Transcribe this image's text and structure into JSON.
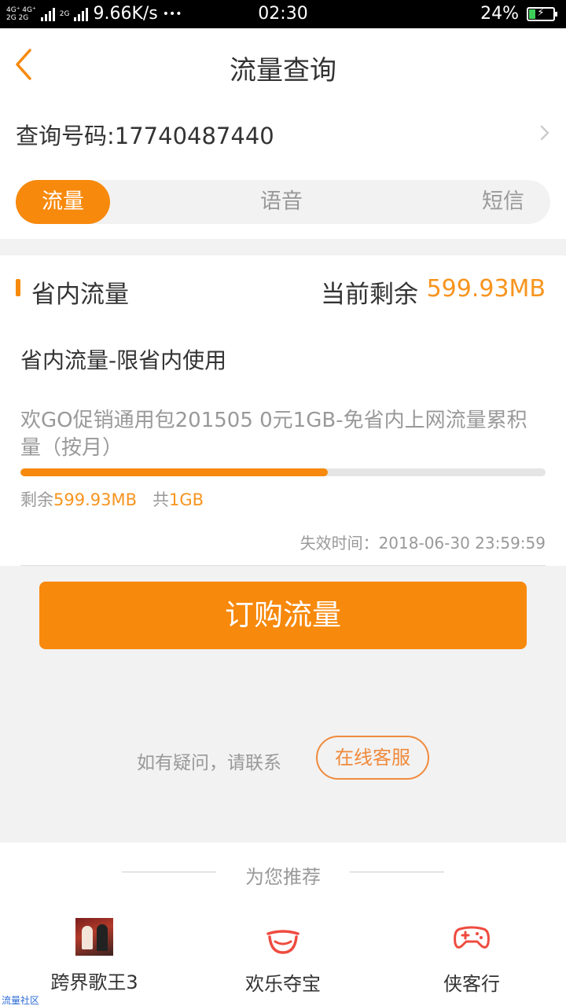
{
  "status_bar": {
    "net_top": "4G⁺ 4G⁺",
    "net_bottom": "2G 2G",
    "net_label": "2G",
    "speed": "9.66K/s",
    "more": "•••",
    "time": "02:30",
    "battery_percent": "24%",
    "battery_level": 0.24
  },
  "nav": {
    "title": "流量查询",
    "back_icon": "chevron-left-icon"
  },
  "query": {
    "label": "查询号码:17740487440",
    "chevron_icon": "chevron-right-icon"
  },
  "tabs": [
    {
      "label": "流量",
      "active": true
    },
    {
      "label": "语音",
      "active": false
    },
    {
      "label": "短信",
      "active": false
    }
  ],
  "section": {
    "title": "省内流量",
    "remain_label": "当前剩余",
    "remain_value": "599.93MB"
  },
  "plan": {
    "title": "省内流量-限省内使用",
    "desc": "欢GO促销通用包201505 0元1GB-免省内上网流量累积量（按月）",
    "usage_remain_label": "剩余",
    "usage_remain_value": "599.93MB",
    "usage_total_label": "共",
    "usage_total_value": "1GB",
    "remaining_fraction": 0.586,
    "expire": "失效时间：2018-06-30 23:59:59"
  },
  "buy_button": "订购流量",
  "help": {
    "text": "如有疑问，请联系",
    "service_button": "在线客服"
  },
  "recommend": {
    "title": "为您推荐",
    "items": [
      {
        "label": "跨界歌王3",
        "icon": "show-thumbnail"
      },
      {
        "label": "欢乐夺宝",
        "icon": "treasure-bowl-icon"
      },
      {
        "label": "侠客行",
        "icon": "gamepad-icon"
      }
    ]
  },
  "watermark": "流量社区",
  "colors": {
    "accent": "#f7890c",
    "accent_text": "#f7941e"
  }
}
